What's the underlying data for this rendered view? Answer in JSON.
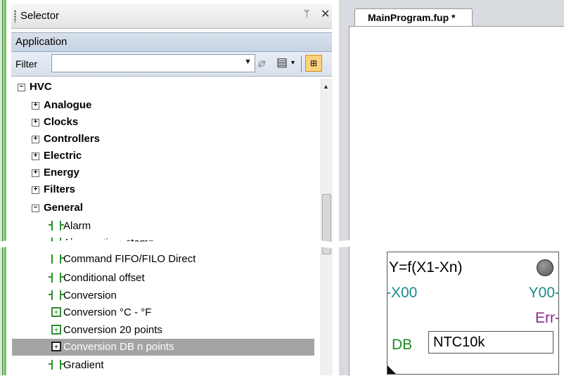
{
  "selector": {
    "title": "Selector",
    "pin_icon": "pin-icon",
    "close_icon": "close-icon",
    "pin_glyph": "ᛘ",
    "close_glyph": "✕",
    "application_label": "Application",
    "filter_label": "Filter",
    "filter_value": "",
    "tree_items": [
      {
        "label": "HVC",
        "expander": "⊟",
        "bold": true
      },
      {
        "label": "Analogue",
        "expander": "⊞",
        "bold": true
      },
      {
        "label": "Clocks",
        "expander": "⊞",
        "bold": true
      },
      {
        "label": "Controllers",
        "expander": "⊞",
        "bold": true
      },
      {
        "label": "Electric",
        "expander": "⊞",
        "bold": true
      },
      {
        "label": "Energy",
        "expander": "⊞",
        "bold": true
      },
      {
        "label": "Filters",
        "expander": "⊞",
        "bold": true
      },
      {
        "label": "General",
        "expander": "⊟",
        "bold": true
      },
      {
        "label": "Alarm"
      },
      {
        "label": "Alarm + time stamp"
      },
      {
        "label": "Command FIFO/FILO Direct"
      },
      {
        "label": "Conditional offset"
      },
      {
        "label": "Conversion"
      },
      {
        "label": "Conversion °C - °F"
      },
      {
        "label": "Conversion 20 points"
      },
      {
        "label": "Conversion DB n points",
        "selected": true
      },
      {
        "label": "Gradient"
      }
    ]
  },
  "editor": {
    "tab_label": "MainProgram.fup *"
  },
  "function_block": {
    "formula": "Y=f(X1-Xn)",
    "input": "-X00",
    "output": "Y00-",
    "error": "Err-",
    "param_label": "DB",
    "param_value": "NTC10k"
  },
  "colors": {
    "selection_bg": "#a4a4a4",
    "input_color": "#1d8a8a",
    "error_color": "#8a2a8a",
    "db_color": "#1f8a1f",
    "block_icon_color": "#2c8f2c"
  }
}
